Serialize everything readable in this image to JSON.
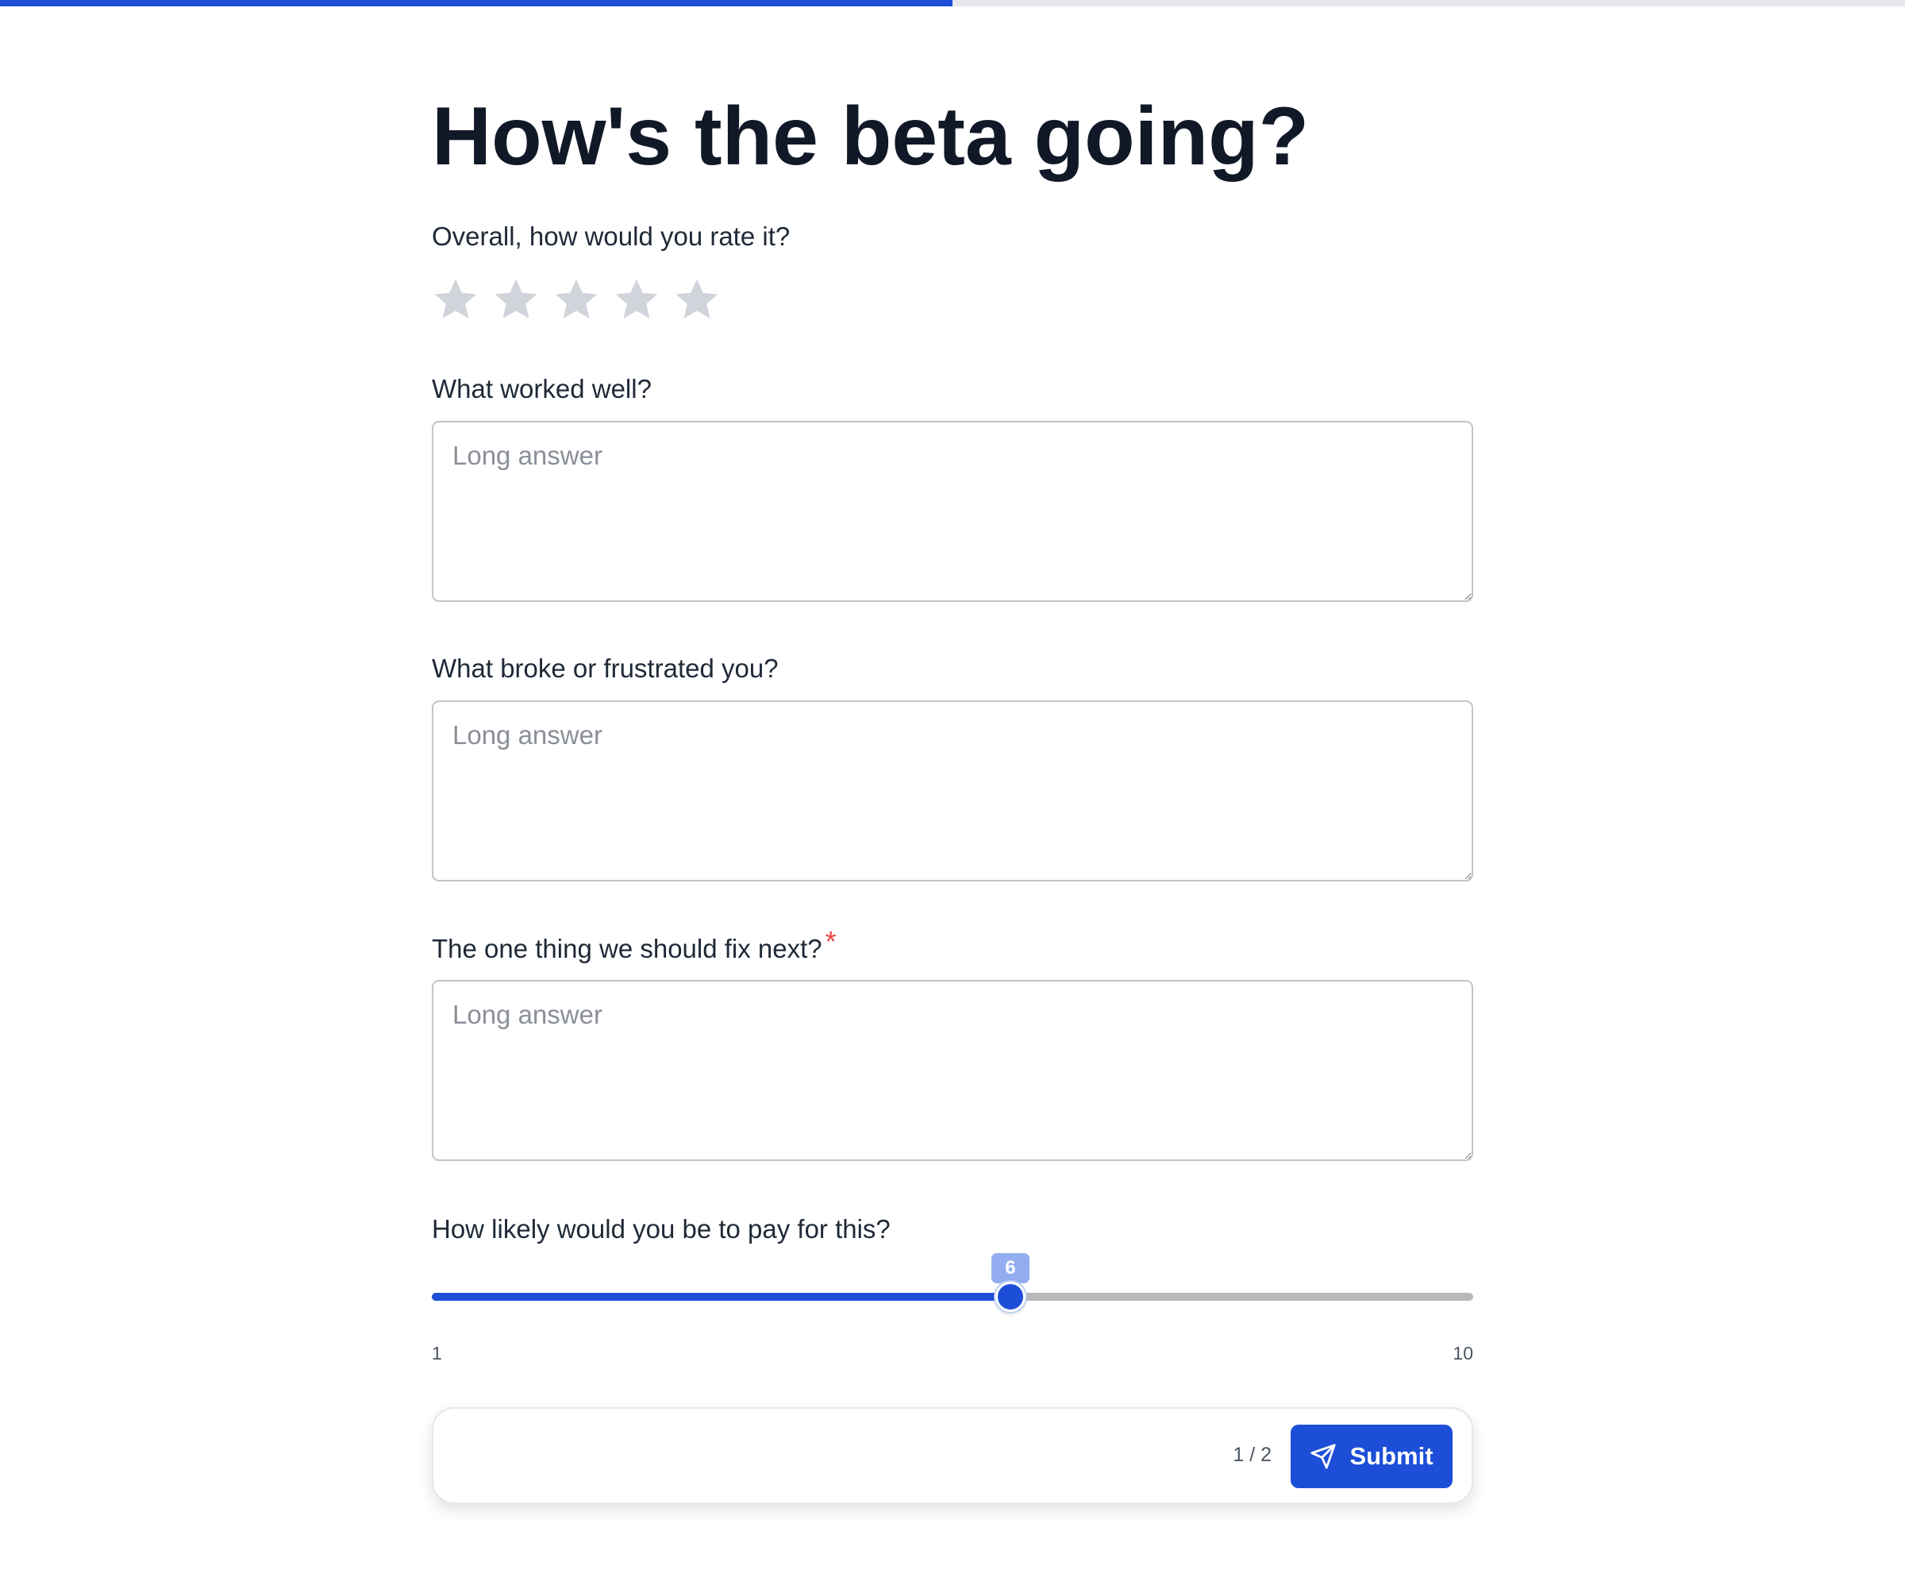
{
  "progress": {
    "fraction": 0.5,
    "fill_color": "#1d4ed8",
    "track_color": "#e5e7eb"
  },
  "form": {
    "title": "How's the beta going?",
    "rating": {
      "label": "Overall, how would you rate it?",
      "max_stars": 5,
      "value": 0,
      "star_icon": "star-icon",
      "empty_color": "#d1d5db"
    },
    "q1": {
      "label": "What worked well?",
      "placeholder": "Long answer",
      "value": ""
    },
    "q2": {
      "label": "What broke or frustrated you?",
      "placeholder": "Long answer",
      "value": ""
    },
    "q3": {
      "label": "The one thing we should fix next?",
      "required_marker": "*",
      "placeholder": "Long answer",
      "value": ""
    },
    "slider": {
      "label": "How likely would you be to pay for this?",
      "min": 1,
      "max": 10,
      "value": 6,
      "min_label": "1",
      "max_label": "10",
      "value_label": "6"
    },
    "footer": {
      "page_indicator": "1 / 2",
      "submit_label": "Submit",
      "submit_icon": "send-icon",
      "accent": "#1d4ed8"
    }
  }
}
